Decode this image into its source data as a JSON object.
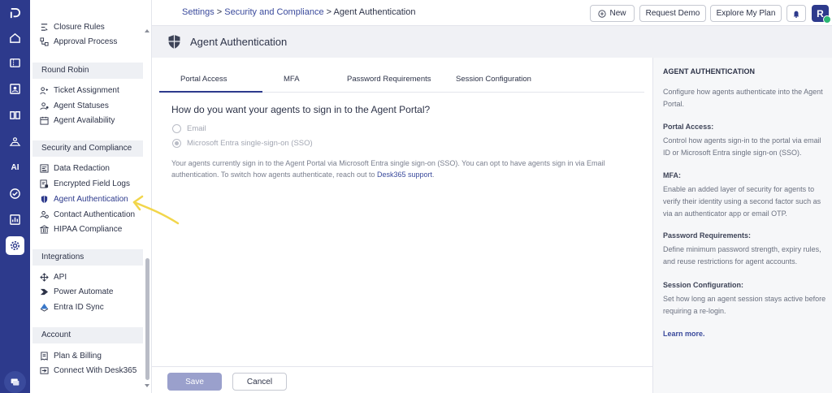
{
  "topbar": {
    "breadcrumb": {
      "item1": "Settings",
      "sep1": " > ",
      "item2": "Security and Compliance",
      "sep2": " > ",
      "current": "Agent Authentication"
    },
    "new_label": "New",
    "request_demo_label": "Request Demo",
    "explore_plan_label": "Explore My Plan",
    "avatar_initial": "R"
  },
  "rail": {
    "icons": [
      "logo-icon",
      "home-icon",
      "ticket-icon",
      "contacts-icon",
      "knowledge-base-icon",
      "community-icon",
      "ai-icon",
      "tasks-icon",
      "reports-icon",
      "settings-icon"
    ],
    "ai_label": "AI"
  },
  "sidebar": {
    "items_top": [
      {
        "label": "Closure Rules",
        "icon": "closure-rules-icon"
      },
      {
        "label": "Approval Process",
        "icon": "approval-icon"
      }
    ],
    "groups": {
      "round_robin": {
        "title": "Round Robin",
        "items": [
          {
            "label": "Ticket Assignment",
            "icon": "ticket-assignment-icon"
          },
          {
            "label": "Agent Statuses",
            "icon": "agent-statuses-icon"
          },
          {
            "label": "Agent Availability",
            "icon": "agent-availability-icon"
          }
        ]
      },
      "security": {
        "title": "Security and Compliance",
        "items": [
          {
            "label": "Data Redaction",
            "icon": "data-redaction-icon"
          },
          {
            "label": "Encrypted Field Logs",
            "icon": "encrypted-logs-icon"
          },
          {
            "label": "Agent Authentication",
            "icon": "shield-icon"
          },
          {
            "label": "Contact Authentication",
            "icon": "contact-auth-icon"
          },
          {
            "label": "HIPAA Compliance",
            "icon": "hipaa-icon"
          }
        ]
      },
      "integrations": {
        "title": "Integrations",
        "items": [
          {
            "label": "API",
            "icon": "api-icon"
          },
          {
            "label": "Power Automate",
            "icon": "power-automate-icon"
          },
          {
            "label": "Entra ID Sync",
            "icon": "entra-sync-icon"
          }
        ]
      },
      "account": {
        "title": "Account",
        "items": [
          {
            "label": "Plan & Billing",
            "icon": "plan-billing-icon"
          },
          {
            "label": "Connect With Desk365",
            "icon": "connect-icon"
          }
        ]
      }
    }
  },
  "page": {
    "title": "Agent Authentication",
    "tabs": [
      "Portal Access",
      "MFA",
      "Password Requirements",
      "Session Configuration"
    ],
    "active_tab": "Portal Access",
    "question": "How do you want your agents to sign in to the Agent Portal?",
    "options": [
      {
        "label": "Email",
        "checked": false
      },
      {
        "label": "Microsoft Entra single-sign-on (SSO)",
        "checked": true
      }
    ],
    "description": "Your agents currently sign in to the Agent Portal via Microsoft Entra single sign-on (SSO). You can opt to have agents sign in via Email authentication. To switch how agents authenticate, reach out to ",
    "support_link": "Desk365 support",
    "description_end": ".",
    "save_label": "Save",
    "cancel_label": "Cancel"
  },
  "help": {
    "title": "AGENT AUTHENTICATION",
    "intro": "Configure how agents authenticate into the Agent Portal.",
    "sections": [
      {
        "heading": "Portal Access:",
        "text": "Control how agents sign-in to the portal via email ID or Microsoft Entra single sign-on (SSO)."
      },
      {
        "heading": "MFA:",
        "text": "Enable an added layer of security for agents to verify their identity using a second factor such as via an authenticator app or email OTP."
      },
      {
        "heading": "Password Requirements:",
        "text": "Define minimum password strength, expiry rules, and reuse restrictions for agent accounts."
      },
      {
        "heading": "Session Configuration:",
        "text": "Set how long an agent session stays active before requiring a re-login."
      }
    ],
    "learn_more": "Learn more."
  },
  "colors": {
    "brand": "#2d3a8c",
    "link": "#3a4a9c",
    "status_online": "#2bb673",
    "annotation_arrow": "#f2d64b"
  }
}
